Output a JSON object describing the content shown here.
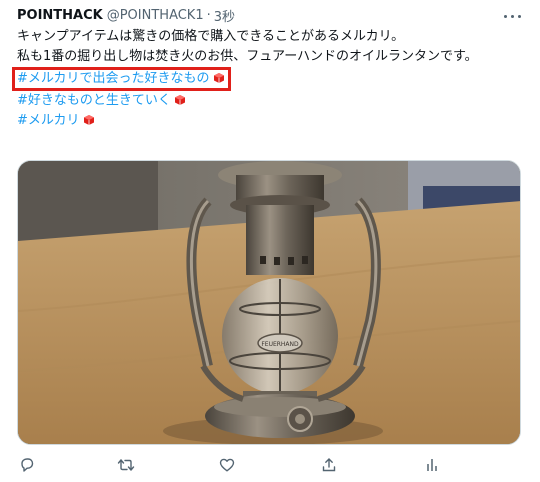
{
  "tweet": {
    "display_name": "POINTHACK",
    "handle": "@POINTHACK1",
    "separator": "·",
    "time": "3秒",
    "lines": [
      "キャンプアイテムは驚きの価格で購入できることがあるメルカリ。",
      "私も1番の掘り出し物は焚き火のお供、フュアーハンドのオイルランタンです。"
    ],
    "hashtags": [
      "#メルカリで出会った好きなもの",
      "#好きなものと生きていく",
      "#メルカリ"
    ]
  },
  "media": {
    "alt": "photo-of-oil-lantern-on-wooden-table",
    "lantern_brand": "FEUERHAND"
  },
  "actions": [
    "reply-icon",
    "retweet-icon",
    "like-icon",
    "share-icon",
    "analytics-icon"
  ],
  "colors": {
    "accent": "#1d9bf0",
    "highlight_box": "#e0201a",
    "text": "#0f1419",
    "muted": "#536471"
  }
}
